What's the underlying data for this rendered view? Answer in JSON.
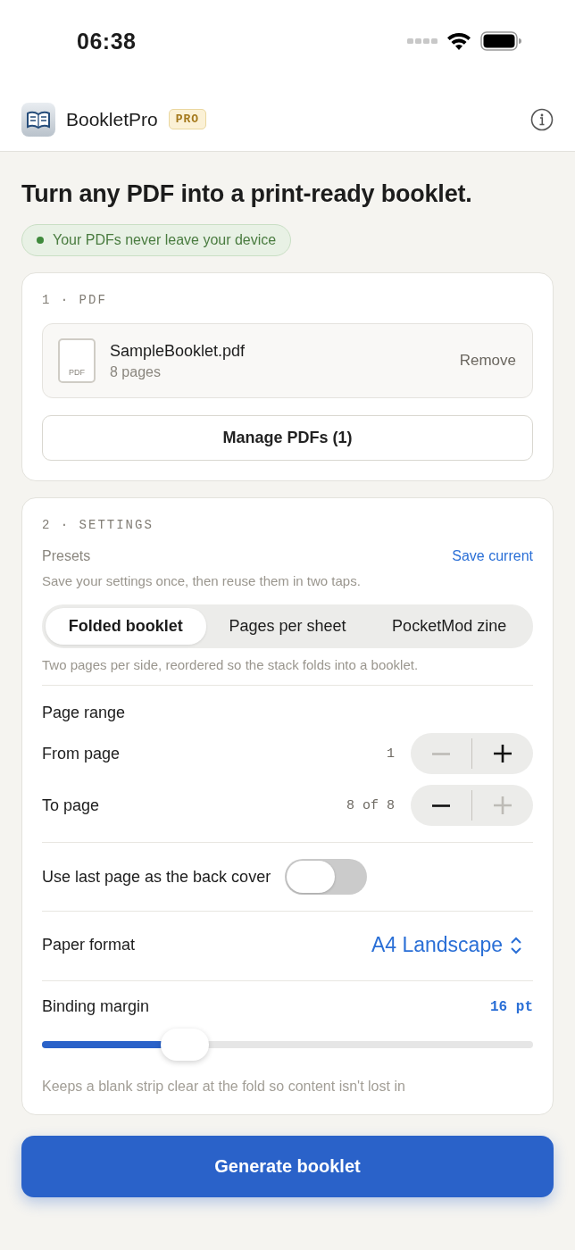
{
  "status_bar": {
    "time": "06:38"
  },
  "header": {
    "app_name": "BookletPro",
    "badge": "PRO"
  },
  "headline": "Turn any PDF into a print-ready booklet.",
  "privacy_pill": "Your PDFs never leave your device",
  "pdf_section": {
    "heading": "1 · PDF",
    "file": {
      "icon_label": "PDF",
      "name": "SampleBooklet.pdf",
      "pages": "8 pages",
      "remove": "Remove"
    },
    "manage_button": "Manage PDFs (1)"
  },
  "settings_section": {
    "heading": "2 · SETTINGS",
    "presets": {
      "label": "Presets",
      "action": "Save current",
      "hint": "Save your settings once, then reuse them in two taps."
    },
    "modes": [
      {
        "label": "Folded booklet",
        "selected": true
      },
      {
        "label": "Pages per sheet",
        "selected": false
      },
      {
        "label": "PocketMod zine",
        "selected": false
      }
    ],
    "mode_hint": "Two pages per side, reordered so the stack folds into a booklet.",
    "page_range": {
      "title": "Page range",
      "rows": [
        {
          "label": "From page",
          "value": "1",
          "decrement_disabled": true,
          "increment_disabled": false
        },
        {
          "label": "To page",
          "value": "8 of 8",
          "decrement_disabled": false,
          "increment_disabled": true
        }
      ]
    },
    "back_cover": {
      "label": "Use last page as the back cover",
      "on": false
    },
    "paper_format": {
      "label": "Paper format",
      "value": "A4 Landscape"
    },
    "binding_margin": {
      "label": "Binding margin",
      "reading": "16 pt",
      "level": 0.29,
      "hint": "Keeps a blank strip clear at the fold so content isn't lost in"
    }
  },
  "generate_button": "Generate booklet"
}
